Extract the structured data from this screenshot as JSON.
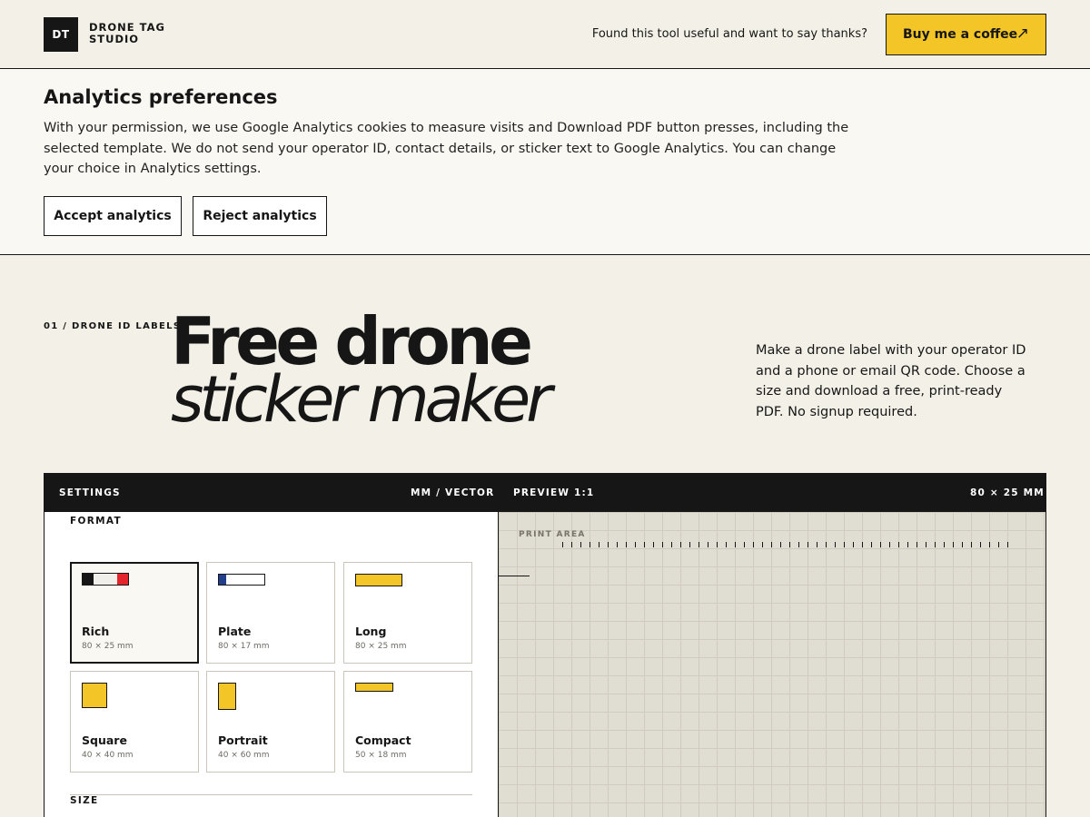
{
  "header": {
    "logo_mark": "DT",
    "logo_line1": "DRONE TAG",
    "logo_line2": "STUDIO",
    "thanks_text": "Found this tool useful and want to say thanks?",
    "coffee_label": "Buy me a coffee",
    "coffee_icon": "arrow-up-right-icon",
    "coffee_color": "#f3c526"
  },
  "consent": {
    "title": "Analytics preferences",
    "body": "With your permission, we use Google Analytics cookies to measure visits and Download PDF button presses, including the selected template. We do not send your operator ID, contact details, or sticker text to Google Analytics. You can change your choice in Analytics settings.",
    "accept_label": "Accept analytics",
    "reject_label": "Reject analytics"
  },
  "hero": {
    "eyebrow": "01 / DRONE ID LABELS",
    "title_line1": "Free drone",
    "title_line2": "sticker maker",
    "description": "Make a drone label with your operator ID and a phone or email QR code. Choose a size and download a free, print-ready PDF. No signup required."
  },
  "panel": {
    "settings_label": "SETTINGS",
    "units_label": "MM / VECTOR",
    "preview_label": "PREVIEW 1:1",
    "preview_size": "80 × 25 MM",
    "format_label": "FORMAT",
    "size_label": "SIZE",
    "print_area_label": "PRINT AREA",
    "formats": [
      {
        "name": "Rich",
        "dims": "80 × 25 mm",
        "selected": true
      },
      {
        "name": "Plate",
        "dims": "80 × 17 mm",
        "selected": false
      },
      {
        "name": "Long",
        "dims": "80 × 25 mm",
        "selected": false
      },
      {
        "name": "Square",
        "dims": "40 × 40 mm",
        "selected": false
      },
      {
        "name": "Portrait",
        "dims": "40 × 60 mm",
        "selected": false
      },
      {
        "name": "Compact",
        "dims": "50 × 18 mm",
        "selected": false
      }
    ]
  },
  "colors": {
    "ink": "#161616",
    "accent_yellow": "#f3c526",
    "accent_red": "#e3262c",
    "accent_blue": "#233e8b",
    "background": "#f3f0e7",
    "preview_grid": "#e0ddd2"
  }
}
